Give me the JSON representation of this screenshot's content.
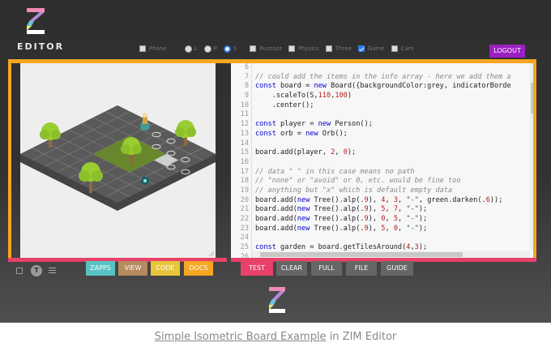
{
  "app": {
    "logo_text": "EDITOR"
  },
  "options": {
    "checkbox_phone": "Phone",
    "radio_l": "L",
    "radio_p": "P",
    "radio_s": "S",
    "checkbox_puzzazz": "Puzzazz",
    "checkbox_physics": "Physics",
    "checkbox_three": "Three",
    "checkbox_game": "Game",
    "checkbox_cam": "Cam",
    "logout": "LOGOUT"
  },
  "buttons": {
    "zapps": "ZAPPS",
    "view": "VIEW",
    "code": "CODE",
    "docs": "DOCS",
    "test": "TEST",
    "clear": "CLEAR",
    "full": "FULL",
    "file": "FILE",
    "guide": "GUIDE"
  },
  "toolbar": {
    "t_label": "T"
  },
  "code": {
    "line_numbers": [
      "6",
      "7",
      "8",
      "9",
      "10",
      "11",
      "12",
      "13",
      "14",
      "15",
      "16",
      "17",
      "18",
      "19",
      "20",
      "21",
      "22",
      "23",
      "24",
      "25",
      "26"
    ],
    "lines": [
      "",
      "// could add the items in the info array - here we add them a",
      "const board = new Board({backgroundColor:grey, indicatorBorde",
      "    .scaleTo(S,110,100)",
      "    .center();",
      "",
      "const player = new Person();",
      "const orb = new Orb();",
      "",
      "board.add(player, 2, 0);",
      "",
      "// data \" \" in this case means no path",
      "// \"none\" or \"avoid\" or 0, etc. would be fine too",
      "// anything but \"x\" which is default empty data",
      "board.add(new Tree().alp(.9), 4, 3, \"-\", green.darken(.6));",
      "board.add(new Tree().alp(.9), 5, 7, \"-\");",
      "board.add(new Tree().alp(.9), 0, 5, \"-\");",
      "board.add(new Tree().alp(.9), 5, 0, \"-\");",
      "",
      "const garden = board.getTilesAround(4,3);",
      ""
    ]
  },
  "caption": {
    "link": "Simple Isometric Board Example",
    "suffix": " in ZIM Editor"
  },
  "colors": {
    "accent_orange": "#f5a623",
    "accent_pink": "#e8416a",
    "logout_purple": "#9b1fc1",
    "tree_green": "#9acd32",
    "garden_green": "#6b8e23"
  }
}
